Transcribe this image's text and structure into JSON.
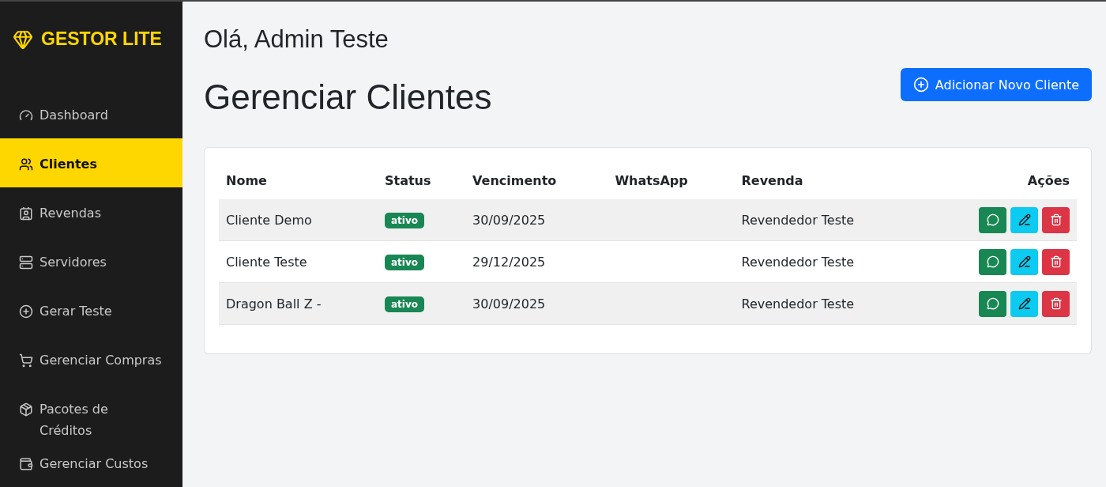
{
  "brand": {
    "name": "GESTOR LITE"
  },
  "sidebar": {
    "items": [
      {
        "label": "Dashboard",
        "selected": false
      },
      {
        "label": "Clientes",
        "selected": true
      },
      {
        "label": "Revendas",
        "selected": false
      },
      {
        "label": "Servidores",
        "selected": false
      },
      {
        "label": "Gerar Teste",
        "selected": false
      },
      {
        "label": "Gerenciar Compras",
        "selected": false
      },
      {
        "label": "Pacotes de Créditos",
        "selected": false
      },
      {
        "label": "Gerenciar Custos",
        "selected": false
      }
    ]
  },
  "greeting": "Olá, Admin Teste",
  "page_title": "Gerenciar Clientes",
  "add_button": {
    "label": "Adicionar Novo Cliente"
  },
  "table": {
    "columns": [
      "Nome",
      "Status",
      "Vencimento",
      "WhatsApp",
      "Revenda",
      "Ações"
    ],
    "rows": [
      {
        "name": "Cliente Demo",
        "status": {
          "label": "ativo",
          "kind": "success"
        },
        "due": "30/09/2025",
        "revenda": "Revendedor Teste"
      },
      {
        "name": "Cliente Teste",
        "status": {
          "label": "ativo",
          "kind": "success"
        },
        "due": "29/12/2025",
        "revenda": "Revendedor Teste"
      },
      {
        "name": "Dragon Ball Z -",
        "status": {
          "label": "ativo",
          "kind": "success"
        },
        "due": "30/09/2025",
        "revenda": "Revendedor Teste"
      }
    ]
  }
}
